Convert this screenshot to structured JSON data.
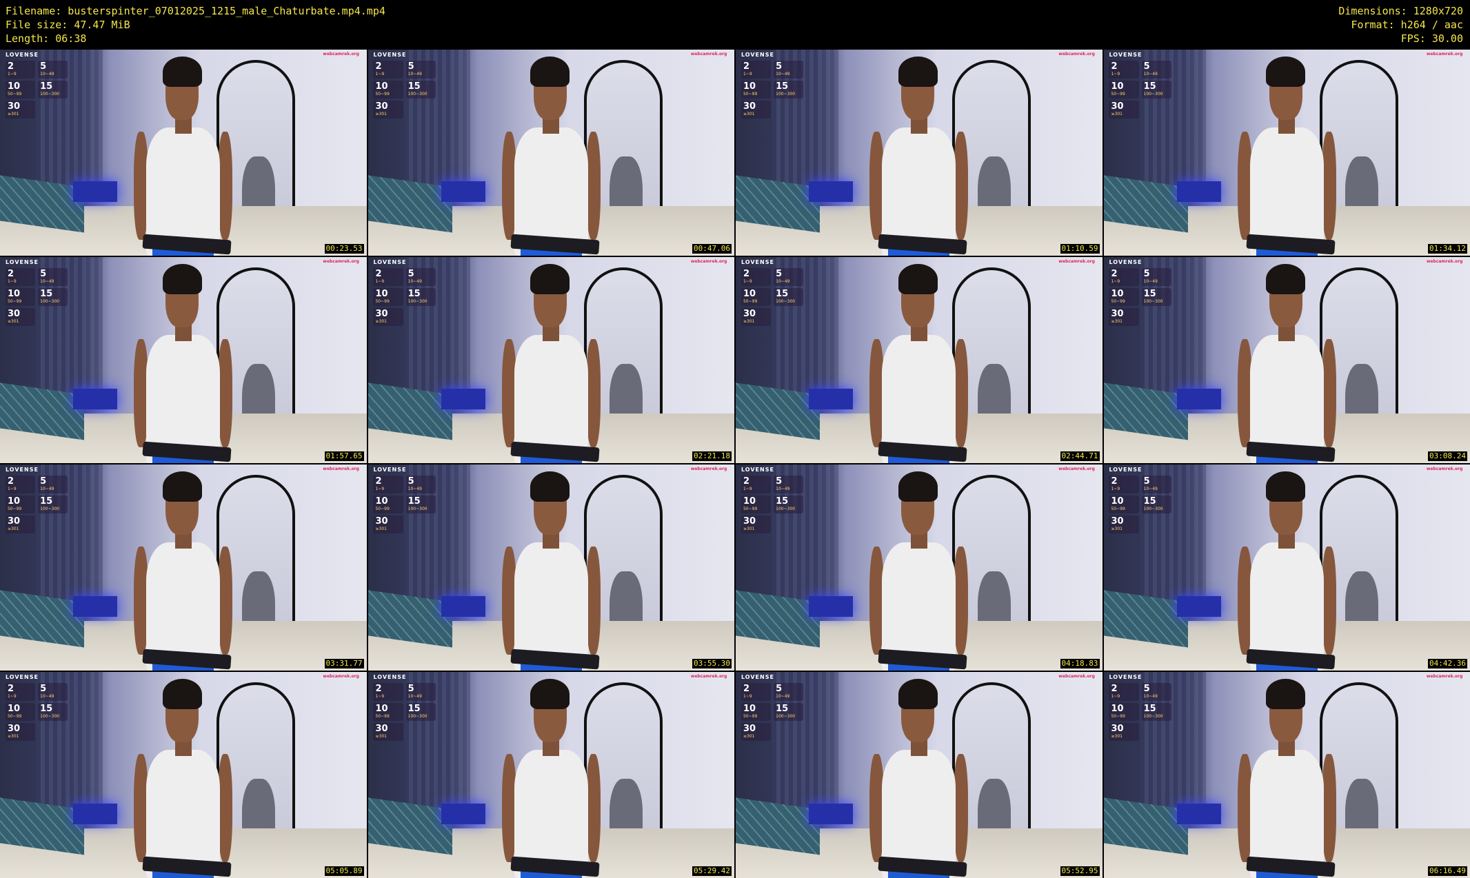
{
  "header": {
    "filename_line": "Filename: busterspinter_07012025_1215_male_Chaturbate.mp4.mp4",
    "filesize_line": "File size: 47.47 MiB",
    "length_line": "Length: 06:38",
    "dimensions_line": "Dimensions: 1280x720",
    "format_line": "Format: h264 / aac",
    "fps_line": "FPS: 30.00"
  },
  "overlay": {
    "brand": "LOVENSE",
    "tiers": [
      {
        "value": "2",
        "range": "1~9"
      },
      {
        "value": "5",
        "range": "10~49"
      },
      {
        "value": "10",
        "range": "50~99"
      },
      {
        "value": "15",
        "range": "100~300"
      },
      {
        "value": "30",
        "range": "≥301"
      }
    ],
    "watermark": "webcamrek.org"
  },
  "thumbnails": [
    {
      "timestamp": "00:23.53"
    },
    {
      "timestamp": "00:47.06"
    },
    {
      "timestamp": "01:10.59"
    },
    {
      "timestamp": "01:34.12"
    },
    {
      "timestamp": "01:57.65"
    },
    {
      "timestamp": "02:21.18"
    },
    {
      "timestamp": "02:44.71"
    },
    {
      "timestamp": "03:08.24"
    },
    {
      "timestamp": "03:31.77"
    },
    {
      "timestamp": "03:55.30"
    },
    {
      "timestamp": "04:18.83"
    },
    {
      "timestamp": "04:42.36"
    },
    {
      "timestamp": "05:05.89"
    },
    {
      "timestamp": "05:29.42"
    },
    {
      "timestamp": "05:52.95"
    },
    {
      "timestamp": "06:16.49"
    }
  ]
}
